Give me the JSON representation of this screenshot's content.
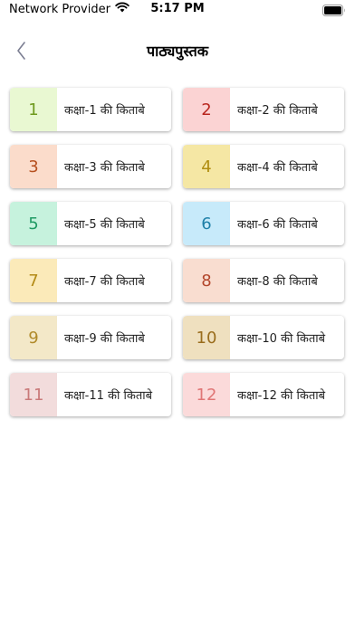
{
  "status_bar": {
    "carrier": "Network Provider",
    "time": "5:17 PM"
  },
  "header": {
    "title": "पाठ्यपुस्तक"
  },
  "books": [
    {
      "number": "1",
      "label": "कक्षा-1 की किताबे",
      "bg": "#e9f8d2",
      "fg": "#6f9a1f"
    },
    {
      "number": "2",
      "label": "कक्षा-2 की किताबे",
      "bg": "#fbd3d3",
      "fg": "#b8261e"
    },
    {
      "number": "3",
      "label": "कक्षा-3 की किताबे",
      "bg": "#fbdccb",
      "fg": "#b6501f"
    },
    {
      "number": "4",
      "label": "कक्षा-4 की किताबे",
      "bg": "#f5e7a4",
      "fg": "#b08d10"
    },
    {
      "number": "5",
      "label": "कक्षा-5 की किताबे",
      "bg": "#c6f2dd",
      "fg": "#1f9a63"
    },
    {
      "number": "6",
      "label": "कक्षा-6 की किताबे",
      "bg": "#c7eafa",
      "fg": "#1f80a8"
    },
    {
      "number": "7",
      "label": "कक्षा-7 की किताबे",
      "bg": "#fbeab9",
      "fg": "#b38a15"
    },
    {
      "number": "8",
      "label": "कक्षा-8 की किताबे",
      "bg": "#f9ddd0",
      "fg": "#b3462b"
    },
    {
      "number": "9",
      "label": "कक्षा-9 की किताबे",
      "bg": "#f3e8c8",
      "fg": "#b08a2a"
    },
    {
      "number": "10",
      "label": "कक्षा-10 की किताबे",
      "bg": "#efe0bf",
      "fg": "#9a6d1d"
    },
    {
      "number": "11",
      "label": "कक्षा-11 की किताबे",
      "bg": "#f2dcdc",
      "fg": "#c97a7a"
    },
    {
      "number": "12",
      "label": "कक्षा-12 की किताबे",
      "bg": "#fbdada",
      "fg": "#e07575"
    }
  ]
}
